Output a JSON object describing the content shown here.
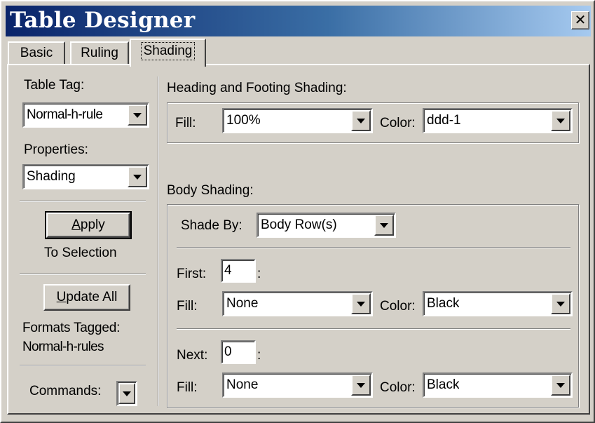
{
  "window": {
    "title": "Table Designer",
    "close_glyph": "✕"
  },
  "tabs": [
    {
      "label": "Basic"
    },
    {
      "label": "Ruling"
    },
    {
      "label": "Shading"
    }
  ],
  "left": {
    "table_tag_label": "Table Tag:",
    "table_tag_value": "Normal-h-rule",
    "properties_label": "Properties:",
    "properties_value": "Shading",
    "apply_button": {
      "mnemonic": "A",
      "rest": "pply"
    },
    "to_selection": "To Selection",
    "update_all_button": {
      "mnemonic": "U",
      "rest": "pdate All"
    },
    "formats_tagged_label": "Formats Tagged:",
    "formats_tagged_value": "Normal-h-rules",
    "commands_label": "Commands:"
  },
  "heading_shading": {
    "title": "Heading and Footing Shading:",
    "fill_label": "Fill:",
    "fill_value": "100%",
    "color_label": "Color:",
    "color_value": "ddd-1"
  },
  "body_shading": {
    "title": "Body Shading:",
    "shade_by_label": "Shade By:",
    "shade_by_value": "Body Row(s)",
    "first_label": "First:",
    "first_value": "4",
    "first_suffix": ":",
    "first_fill_label": "Fill:",
    "first_fill_value": "None",
    "first_color_label": "Color:",
    "first_color_value": "Black",
    "next_label": "Next:",
    "next_value": "0",
    "next_suffix": ":",
    "next_fill_label": "Fill:",
    "next_fill_value": "None",
    "next_color_label": "Color:",
    "next_color_value": "Black"
  },
  "colors": {
    "face": "#d4d0c8",
    "title_start": "#0a246a",
    "title_end": "#a6caf0"
  }
}
